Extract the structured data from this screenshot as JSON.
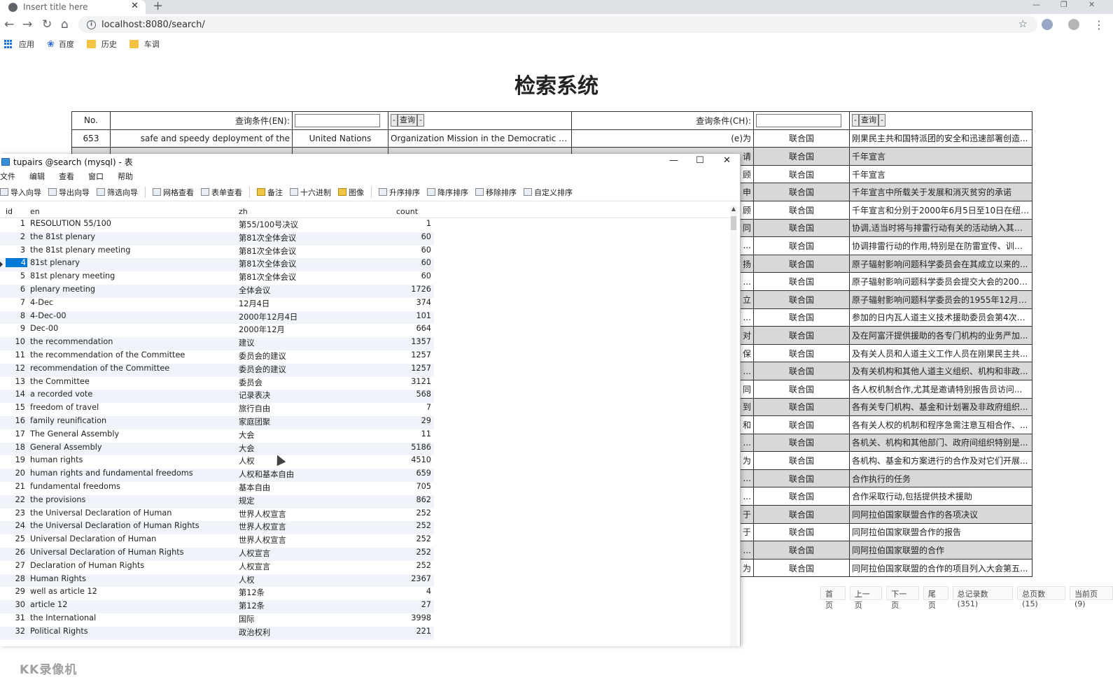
{
  "browser": {
    "tab_title": "Insert title here",
    "tab_close": "✕",
    "new_tab": "+",
    "url": "localhost:8080/search/",
    "bookmarks": [
      "应用",
      "百度",
      "历史",
      "车调"
    ]
  },
  "page": {
    "title": "检索系统",
    "header": {
      "no": "No.",
      "en_label": "查询条件(EN):",
      "ch_label": "查询条件(CH):",
      "prev": "-",
      "query": "查询",
      "next": "-"
    },
    "rows": [
      {
        "no": "653",
        "en": "safe and speedy deployment of the",
        "en_org": "United Nations",
        "en_text": "Organization Mission in the Democratic Repu...",
        "ch_term": "(e)为",
        "ch_org": "联合国",
        "ch_text": "刚果民主共和国特派团的安全和迅速部署创造..."
      },
      {
        "no": "",
        "en": "",
        "en_org": "",
        "en_text": "",
        "ch_term": "请",
        "ch_org": "联合国",
        "ch_text": "千年宣言"
      },
      {
        "no": "",
        "en": "",
        "en_org": "",
        "en_text": "",
        "ch_term": "顾",
        "ch_org": "联合国",
        "ch_text": "千年宣言"
      },
      {
        "no": "",
        "en": "",
        "en_org": "",
        "en_text": "",
        "ch_term": "申",
        "ch_org": "联合国",
        "ch_text": "千年宣言中所载关于发展和消灭贫穷的承诺"
      },
      {
        "no": "",
        "en": "",
        "en_org": "",
        "en_text": "",
        "ch_term": "顾",
        "ch_org": "联合国",
        "ch_text": "千年宣言和分别于2000年6月5日至10日在纽约..."
      },
      {
        "no": "",
        "en": "",
        "en_org": "",
        "en_text": "",
        "ch_term": "同",
        "ch_org": "联合国",
        "ch_text": "协调,适当时将与排雷行动有关的活动纳入其人..."
      },
      {
        "no": "",
        "en": "",
        "en_org": "",
        "en_text": "",
        "ch_term": "...",
        "ch_org": "联合国",
        "ch_text": "协调排雷行动的作用,特别是在防雷宣传、训练..."
      },
      {
        "no": "",
        "en": "",
        "en_org": "",
        "en_text": "",
        "ch_term": "扬",
        "ch_org": "联合国",
        "ch_text": "原子辐射影响问题科学委员会在其成立以来的..."
      },
      {
        "no": "",
        "en": "",
        "en_org": "",
        "en_text": "",
        "ch_term": "...",
        "ch_org": "联合国",
        "ch_text": "原子辐射影响问题科学委员会提交大会的2000..."
      },
      {
        "no": "",
        "en": "",
        "en_org": "",
        "en_text": "",
        "ch_term": "立",
        "ch_org": "联合国",
        "ch_text": "原子辐射影响问题科学委员会的1955年12月3..."
      },
      {
        "no": "",
        "en": "",
        "en_org": "",
        "en_text": "",
        "ch_term": "...",
        "ch_org": "联合国",
        "ch_text": "参加的日内瓦人道主义技术援助委员会第4次会..."
      },
      {
        "no": "",
        "en": "",
        "en_org": "",
        "en_text": "",
        "ch_term": "对",
        "ch_org": "联合国",
        "ch_text": "及在阿富汗提供援助的各专门机构的业务严加..."
      },
      {
        "no": "",
        "en": "",
        "en_org": "",
        "en_text": "",
        "ch_term": "保",
        "ch_org": "联合国",
        "ch_text": "及有关人员和人道主义工作人员在刚果民主共..."
      },
      {
        "no": "",
        "en": "",
        "en_org": "",
        "en_text": "",
        "ch_term": "...",
        "ch_org": "联合国",
        "ch_text": "及有关机构和其他人道主义组织、机构和非政..."
      },
      {
        "no": "",
        "en": "",
        "en_org": "",
        "en_text": "",
        "ch_term": "同",
        "ch_org": "联合国",
        "ch_text": "各人权机制合作,尤其是邀请特别报告员访问..."
      },
      {
        "no": "",
        "en": "",
        "en_org": "",
        "en_text": "",
        "ch_term": "到",
        "ch_org": "联合国",
        "ch_text": "各有关专门机构、基金和计划署及非政府组织..."
      },
      {
        "no": "",
        "en": "",
        "en_org": "",
        "en_text": "",
        "ch_term": "和",
        "ch_org": "联合国",
        "ch_text": "各有关人权的机制和程序急需注意互相合作、..."
      },
      {
        "no": "",
        "en": "",
        "en_org": "",
        "en_text": "",
        "ch_term": "...",
        "ch_org": "联合国",
        "ch_text": "各机关、机构和其他部门、政府间组织特别是..."
      },
      {
        "no": "",
        "en": "",
        "en_org": "",
        "en_text": "",
        "ch_term": "为",
        "ch_org": "联合国",
        "ch_text": "各机构、基金和方案进行的合作及对它们开展..."
      },
      {
        "no": "",
        "en": "",
        "en_org": "",
        "en_text": "",
        "ch_term": "...",
        "ch_org": "联合国",
        "ch_text": "合作执行的任务"
      },
      {
        "no": "",
        "en": "",
        "en_org": "",
        "en_text": "",
        "ch_term": "...",
        "ch_org": "联合国",
        "ch_text": "合作采取行动,包括提供技术援助"
      },
      {
        "no": "",
        "en": "",
        "en_org": "",
        "en_text": "",
        "ch_term": "于",
        "ch_org": "联合国",
        "ch_text": "同阿拉伯国家联盟合作的各项决议"
      },
      {
        "no": "",
        "en": "",
        "en_org": "",
        "en_text": "",
        "ch_term": "于",
        "ch_org": "联合国",
        "ch_text": "同阿拉伯国家联盟合作的报告"
      },
      {
        "no": "",
        "en": "",
        "en_org": "",
        "en_text": "",
        "ch_term": "...",
        "ch_org": "联合国",
        "ch_text": "同阿拉伯国家联盟的合作"
      },
      {
        "no": "",
        "en": "",
        "en_org": "",
        "en_text": "",
        "ch_term": "为",
        "ch_org": "联合国",
        "ch_text": "同阿拉伯国家联盟的合作的项目列入大会第五..."
      }
    ],
    "pager": [
      "首页",
      "上一页",
      "下一页",
      "尾页",
      "总记录数(351)",
      "总页数(15)",
      "当前页(9)"
    ]
  },
  "db_window": {
    "title": "tupairs @search (mysql) - 表",
    "menu": [
      "文件",
      "编辑",
      "查看",
      "窗口",
      "帮助"
    ],
    "tools": [
      "导入向导",
      "导出向导",
      "筛选向导",
      "网格查看",
      "表单查看",
      "备注",
      "十六进制",
      "图像",
      "升序排序",
      "降序排序",
      "移除排序",
      "自定义排序"
    ],
    "columns": [
      "id",
      "en",
      "zh",
      "count"
    ],
    "selected_id": 4,
    "rows": [
      {
        "id": "1",
        "en": "RESOLUTION 55/100",
        "zh": "第55/100号决议",
        "count": "1"
      },
      {
        "id": "2",
        "en": "the 81st plenary",
        "zh": "第81次全体会议",
        "count": "60"
      },
      {
        "id": "3",
        "en": "the 81st plenary meeting",
        "zh": "第81次全体会议",
        "count": "60"
      },
      {
        "id": "4",
        "en": "81st plenary",
        "zh": "第81次全体会议",
        "count": "60"
      },
      {
        "id": "5",
        "en": "81st plenary meeting",
        "zh": "第81次全体会议",
        "count": "60"
      },
      {
        "id": "6",
        "en": "plenary meeting",
        "zh": "全体会议",
        "count": "1726"
      },
      {
        "id": "7",
        "en": "4-Dec",
        "zh": "12月4日",
        "count": "374"
      },
      {
        "id": "8",
        "en": "4-Dec-00",
        "zh": "2000年12月4日",
        "count": "101"
      },
      {
        "id": "9",
        "en": "Dec-00",
        "zh": "2000年12月",
        "count": "664"
      },
      {
        "id": "10",
        "en": "the recommendation",
        "zh": "建议",
        "count": "1357"
      },
      {
        "id": "11",
        "en": "the recommendation of the Committee",
        "zh": "委员会的建议",
        "count": "1257"
      },
      {
        "id": "12",
        "en": "recommendation of the Committee",
        "zh": "委员会的建议",
        "count": "1257"
      },
      {
        "id": "13",
        "en": "the Committee",
        "zh": "委员会",
        "count": "3121"
      },
      {
        "id": "14",
        "en": "a recorded vote",
        "zh": "记录表决",
        "count": "568"
      },
      {
        "id": "15",
        "en": "freedom of travel",
        "zh": "旅行自由",
        "count": "7"
      },
      {
        "id": "16",
        "en": "family reunification",
        "zh": "家庭团聚",
        "count": "29"
      },
      {
        "id": "17",
        "en": "The General Assembly",
        "zh": "大会",
        "count": "11"
      },
      {
        "id": "18",
        "en": "General Assembly",
        "zh": "大会",
        "count": "5186"
      },
      {
        "id": "19",
        "en": "human rights",
        "zh": "人权",
        "count": "4510"
      },
      {
        "id": "20",
        "en": "human rights and fundamental freedoms",
        "zh": "人权和基本自由",
        "count": "659"
      },
      {
        "id": "21",
        "en": "fundamental freedoms",
        "zh": "基本自由",
        "count": "705"
      },
      {
        "id": "22",
        "en": "the provisions",
        "zh": "规定",
        "count": "862"
      },
      {
        "id": "23",
        "en": "the Universal Declaration of Human",
        "zh": "世界人权宣言",
        "count": "252"
      },
      {
        "id": "24",
        "en": "the Universal Declaration of Human Rights",
        "zh": "世界人权宣言",
        "count": "252"
      },
      {
        "id": "25",
        "en": "Universal Declaration of Human",
        "zh": "世界人权宣言",
        "count": "252"
      },
      {
        "id": "26",
        "en": "Universal Declaration of Human Rights",
        "zh": "人权宣言",
        "count": "252"
      },
      {
        "id": "27",
        "en": "Declaration of Human Rights",
        "zh": "人权宣言",
        "count": "252"
      },
      {
        "id": "28",
        "en": "Human Rights",
        "zh": "人权",
        "count": "2367"
      },
      {
        "id": "29",
        "en": "well as article 12",
        "zh": "第12条",
        "count": "4"
      },
      {
        "id": "30",
        "en": "article 12",
        "zh": "第12条",
        "count": "27"
      },
      {
        "id": "31",
        "en": "the International",
        "zh": "国际",
        "count": "3998"
      },
      {
        "id": "32",
        "en": "Political Rights",
        "zh": "政治权利",
        "count": "221"
      }
    ]
  },
  "watermark": "KK录像机"
}
